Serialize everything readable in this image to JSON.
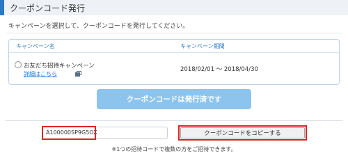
{
  "header": {
    "title": "クーポンコード発行"
  },
  "instruction": "キャンペーンを選択して、クーポンコードを発行してください。",
  "table": {
    "col_name": "キャンペーン名",
    "col_period": "キャンペーン期間",
    "rows": [
      {
        "name": "お友だち招待キャンペーン",
        "detail_link": "詳細はこちら",
        "period": "2018/02/01 ～ 2018/04/30",
        "selected": false
      }
    ]
  },
  "issued_button_label": "クーポンコードは発行済です",
  "coupon": {
    "code": "A100000SP9G5OX",
    "copy_label": "クーポンコードをコピーする"
  },
  "note": "※1つの招待コードで複数の方をご招待できます。",
  "colors": {
    "accent": "#2b78c5",
    "issued_button": "#8cc4ee",
    "highlight": "#d9262b"
  }
}
